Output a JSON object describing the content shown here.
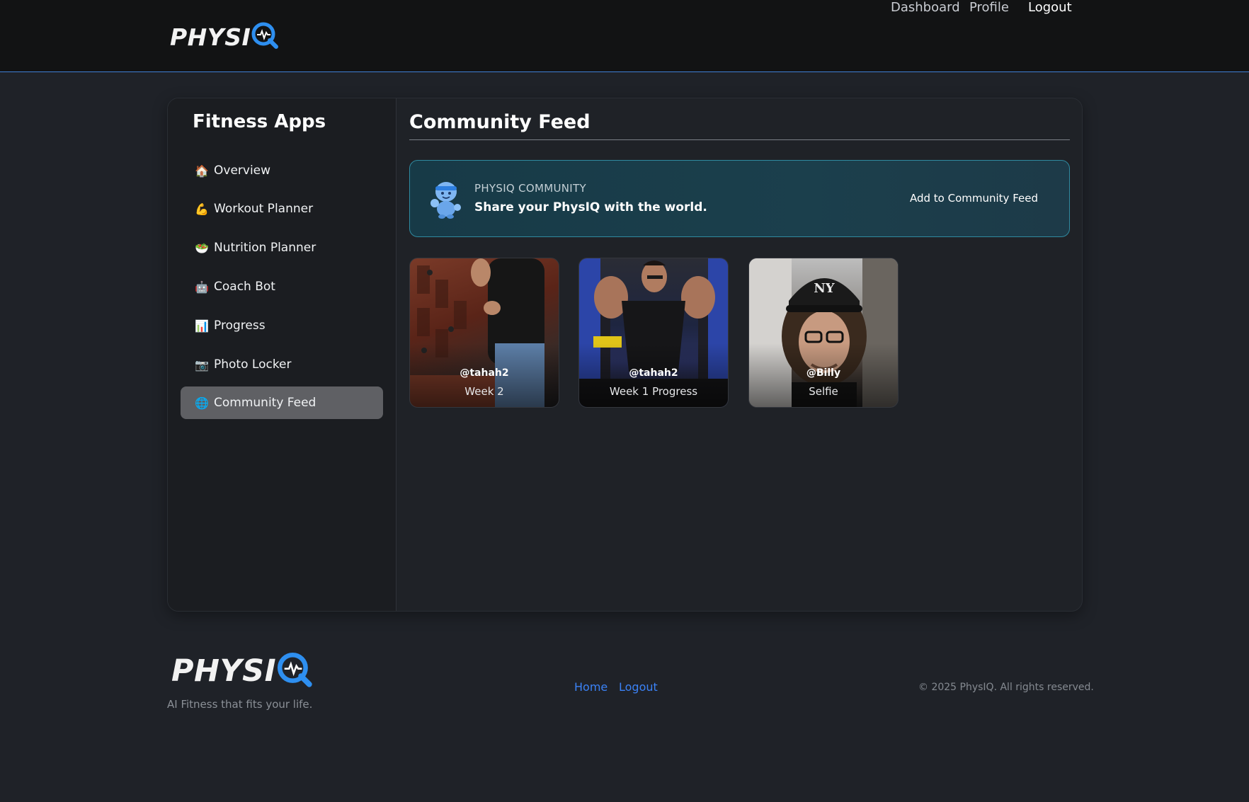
{
  "header": {
    "logo": {
      "text_main": "PHYSI",
      "text_q": "Q"
    },
    "nav": [
      {
        "label": "Dashboard"
      },
      {
        "label": "Profile"
      },
      {
        "label": "Logout"
      }
    ]
  },
  "sidebar": {
    "title": "Fitness Apps",
    "items": [
      {
        "icon": "🏠",
        "icon_name": "house-icon",
        "label": "Overview",
        "active": false
      },
      {
        "icon": "💪",
        "icon_name": "flexed-bicep-icon",
        "label": "Workout Planner",
        "active": false
      },
      {
        "icon": "🥗",
        "icon_name": "salad-bowl-icon",
        "label": "Nutrition Planner",
        "active": false
      },
      {
        "icon": "🤖",
        "icon_name": "robot-icon",
        "label": "Coach Bot",
        "active": false
      },
      {
        "icon": "📊",
        "icon_name": "bar-chart-icon",
        "label": "Progress",
        "active": false
      },
      {
        "icon": "📷",
        "icon_name": "camera-icon",
        "label": "Photo Locker",
        "active": false
      },
      {
        "icon": "🌐",
        "icon_name": "globe-icon",
        "label": "Community Feed",
        "active": true
      }
    ]
  },
  "main": {
    "title": "Community Feed",
    "banner": {
      "kicker": "PHYSIQ COMMUNITY",
      "tagline": "Share your PhysIQ with the world.",
      "cta": "Add to Community Feed"
    },
    "posts": [
      {
        "user": "@tahah2",
        "caption": "Week 2"
      },
      {
        "user": "@tahah2",
        "caption": "Week 1 Progress"
      },
      {
        "user": "@Billy",
        "caption": "Selfie"
      }
    ]
  },
  "footer": {
    "logo": {
      "text_main": "PHYSI",
      "text_q": "Q"
    },
    "tagline": "AI Fitness that fits your life.",
    "links": [
      {
        "label": "Home"
      },
      {
        "label": "Logout"
      }
    ],
    "copyright": "© 2025 PhysIQ. All rights reserved."
  },
  "colors": {
    "accent_blue": "#3b82f6",
    "logo_blue": "#2e8ff0",
    "banner_border": "#2f8aa0",
    "active_item_bg": "#5f6064"
  }
}
